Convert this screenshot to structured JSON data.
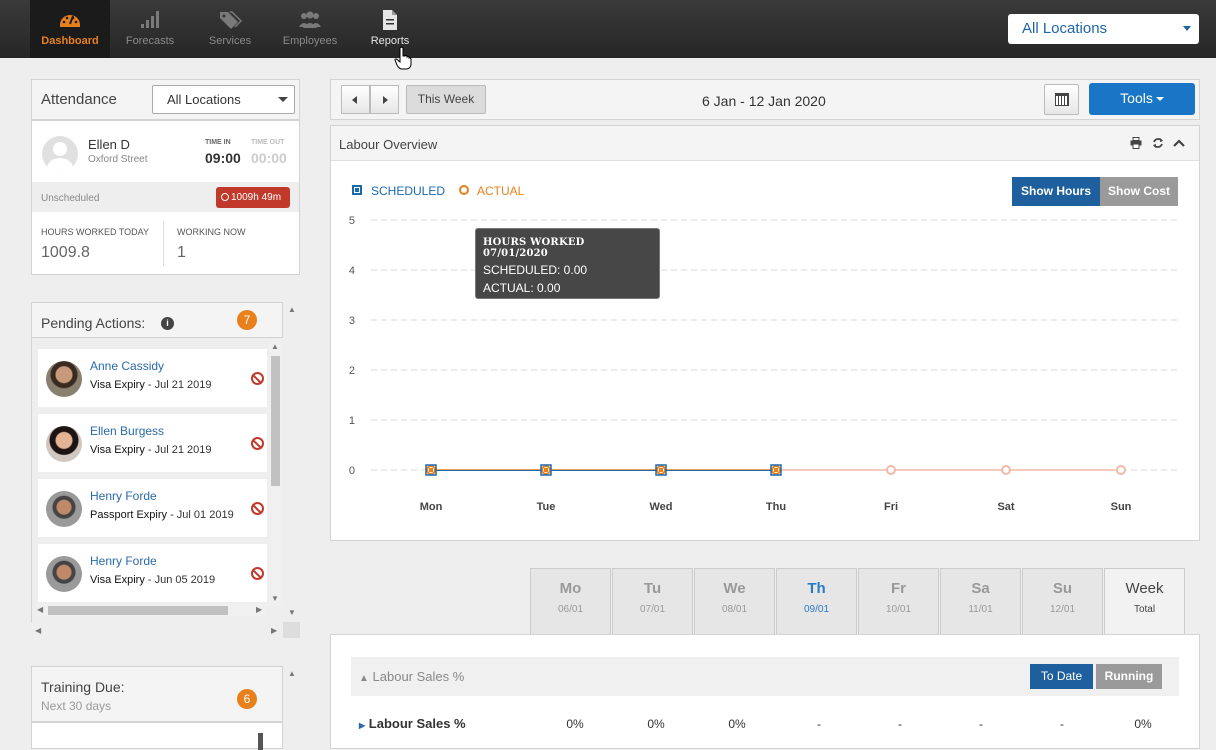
{
  "nav": {
    "items": [
      {
        "label": "Dashboard",
        "icon": "dashboard-icon"
      },
      {
        "label": "Forecasts",
        "icon": "signal-bars-icon"
      },
      {
        "label": "Services",
        "icon": "tags-icon"
      },
      {
        "label": "Employees",
        "icon": "users-icon"
      },
      {
        "label": "Reports",
        "icon": "document-icon"
      }
    ],
    "location_select": "All Locations"
  },
  "attendance": {
    "title": "Attendance",
    "location_select": "All Locations",
    "employee": {
      "name": "Ellen D",
      "location": "Oxford Street"
    },
    "time_in_label": "TIME IN",
    "time_in": "09:00",
    "time_out_label": "TIME OUT",
    "time_out": "00:00",
    "status": "Unscheduled",
    "duration_badge": "1009h 49m",
    "hours_worked_label": "HOURS WORKED TODAY",
    "hours_worked": "1009.8",
    "working_now_label": "WORKING NOW",
    "working_now": "1"
  },
  "pending": {
    "title": "Pending Actions:",
    "count": "7",
    "items": [
      {
        "name": "Anne Cassidy",
        "type": "Visa Expiry",
        "date": " - Jul 21 2019"
      },
      {
        "name": "Ellen Burgess",
        "type": "Visa Expiry",
        "date": " - Jul 21 2019"
      },
      {
        "name": "Henry Forde",
        "type": "Passport Expiry",
        "date": " - Jul 01 2019"
      },
      {
        "name": "Henry Forde",
        "type": "Visa Expiry",
        "date": " - Jun 05 2019"
      }
    ]
  },
  "training": {
    "title": "Training Due:",
    "subtitle": "Next 30 days",
    "count": "6"
  },
  "week": {
    "this_week": "This Week",
    "range": "6 Jan - 12 Jan 2020",
    "tools": "Tools"
  },
  "labour": {
    "title": "Labour Overview",
    "legend_scheduled": "SCHEDULED",
    "legend_actual": "ACTUAL",
    "show_hours": "Show Hours",
    "show_cost": "Show Cost",
    "tooltip": {
      "title": "HOURS WORKED 07/01/2020",
      "scheduled": "SCHEDULED: 0.00",
      "actual": "ACTUAL: 0.00"
    }
  },
  "chart_data": {
    "type": "line",
    "categories": [
      "Mon",
      "Tue",
      "Wed",
      "Thu",
      "Fri",
      "Sat",
      "Sun"
    ],
    "series": [
      {
        "name": "SCHEDULED",
        "values": [
          0,
          0,
          0,
          0,
          null,
          null,
          null
        ],
        "color": "#1a6ab0"
      },
      {
        "name": "ACTUAL",
        "values": [
          0,
          0,
          0,
          0,
          0,
          0,
          0
        ],
        "color": "#e8811c"
      }
    ],
    "yticks": [
      "0",
      "1",
      "2",
      "3",
      "4",
      "5"
    ],
    "ylim": [
      0,
      5
    ],
    "grid": true
  },
  "days": [
    {
      "name": "Mo",
      "date": "06/01"
    },
    {
      "name": "Tu",
      "date": "07/01"
    },
    {
      "name": "We",
      "date": "08/01"
    },
    {
      "name": "Th",
      "date": "09/01"
    },
    {
      "name": "Fr",
      "date": "10/01"
    },
    {
      "name": "Sa",
      "date": "11/01"
    },
    {
      "name": "Su",
      "date": "12/01"
    },
    {
      "name": "Week",
      "date": "Total"
    }
  ],
  "sales": {
    "section_title": "Labour Sales %",
    "to_date": "To Date",
    "running": "Running",
    "row_label": "Labour Sales %",
    "values": [
      "0%",
      "0%",
      "0%",
      "-",
      "-",
      "-",
      "-",
      "0%"
    ]
  },
  "colors": {
    "accent": "#e8811c",
    "primary": "#1976c7",
    "danger": "#c0392b"
  }
}
